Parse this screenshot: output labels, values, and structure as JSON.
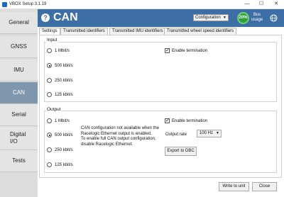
{
  "window": {
    "title": "VBOX Setup 3.1.19",
    "min": "—",
    "max": "☐",
    "close": "✕"
  },
  "sidebar": {
    "items": [
      {
        "label": "General"
      },
      {
        "label": "GNSS"
      },
      {
        "label": "IMU"
      },
      {
        "label": "CAN",
        "active": true
      },
      {
        "label": "Serial"
      },
      {
        "label": "Digital I/O"
      },
      {
        "label": "Tests"
      }
    ]
  },
  "header": {
    "title": "CAN",
    "help": "?",
    "config_value": "Configuration",
    "bus_usage_value": "20%",
    "bus_usage_label": "Bus usage"
  },
  "tabs": [
    {
      "label": "Settings",
      "active": true
    },
    {
      "label": "Transmitted identifiers"
    },
    {
      "label": "Transmitted IMU identifiers"
    },
    {
      "label": "Transmitted wheel speed identifiers"
    }
  ],
  "input": {
    "title": "Input",
    "rates": [
      "1 Mbit/s",
      "500 kbit/s",
      "250 kbit/s",
      "125 kbit/s"
    ],
    "selected": "500 kbit/s",
    "termination_label": "Enable termination",
    "termination_checked": true
  },
  "output": {
    "title": "Output",
    "rates": [
      "1 Mbit/s",
      "500 kbit/s",
      "250 kbit/s",
      "125 kbit/s"
    ],
    "selected": "500 kbit/s",
    "termination_label": "Enable termination",
    "termination_checked": true,
    "note_line1": "CAN configuration not available when the Racelogic Ethernet output is enabled.",
    "note_line2": "To enable full CAN output configuration, disable Racelogic Ethernet.",
    "rate_label": "Output rate",
    "rate_value": "100 Hz",
    "export_label": "Export to DBC"
  },
  "footer": {
    "write_label": "Write to unit",
    "close_label": "Close"
  },
  "colors": {
    "header": "#3d6ea5",
    "active_nav": "#7f97ad",
    "bus_gauge": "#2e9e3c"
  }
}
